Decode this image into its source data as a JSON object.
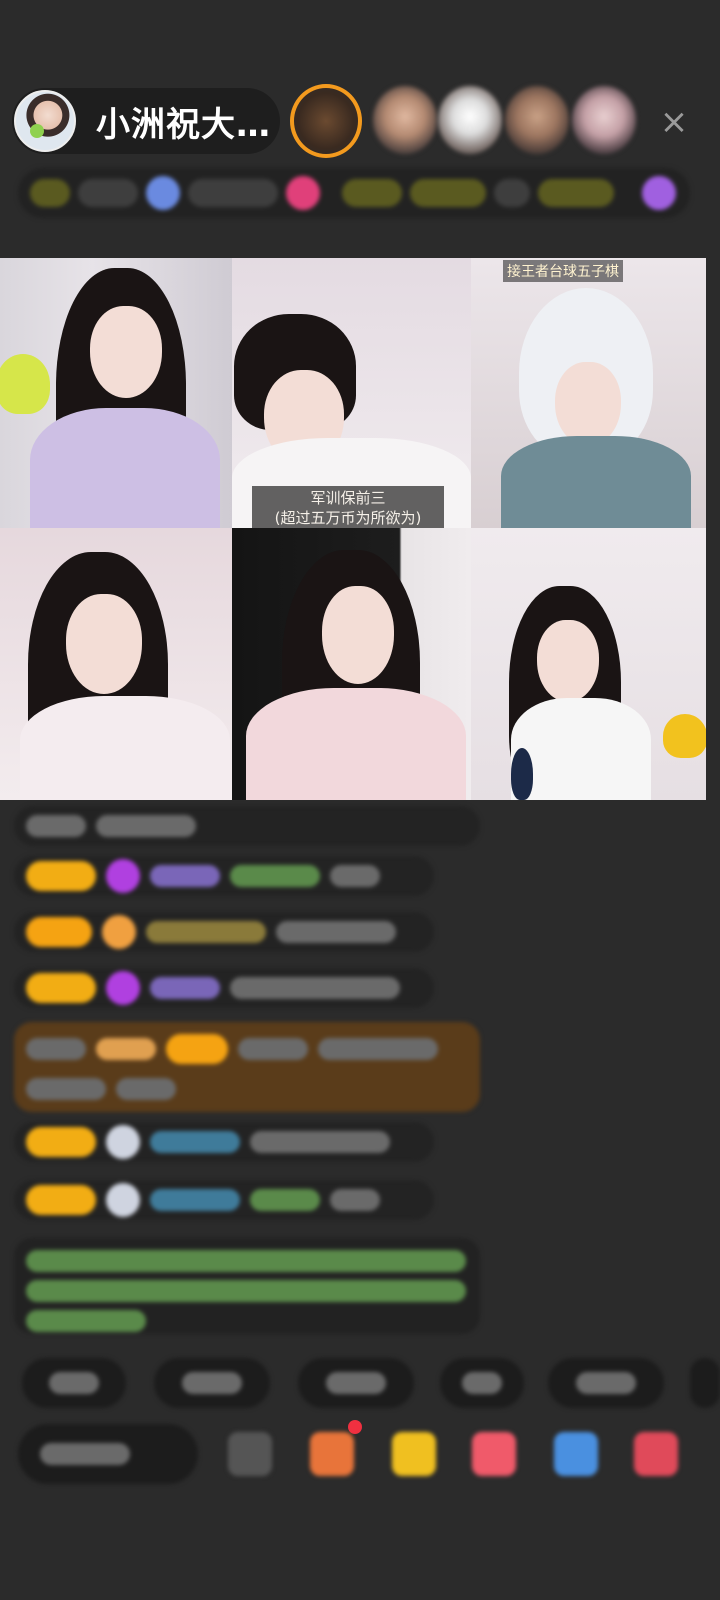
{
  "header": {
    "host_name": "小洲祝大…",
    "close_label": "×"
  },
  "video_grid": {
    "cell2_caption_line1": "军训保前三",
    "cell2_caption_line2": "(超过五万币为所欲为)",
    "cell3_label": "接王者台球五子棋"
  },
  "icons": {
    "close": "close-icon",
    "gift": "gift-icon",
    "emoji": "emoji-icon"
  },
  "colors": {
    "background": "#2b2b2b",
    "badge": "#f2ad14",
    "accent_orange": "#f39a1e"
  }
}
